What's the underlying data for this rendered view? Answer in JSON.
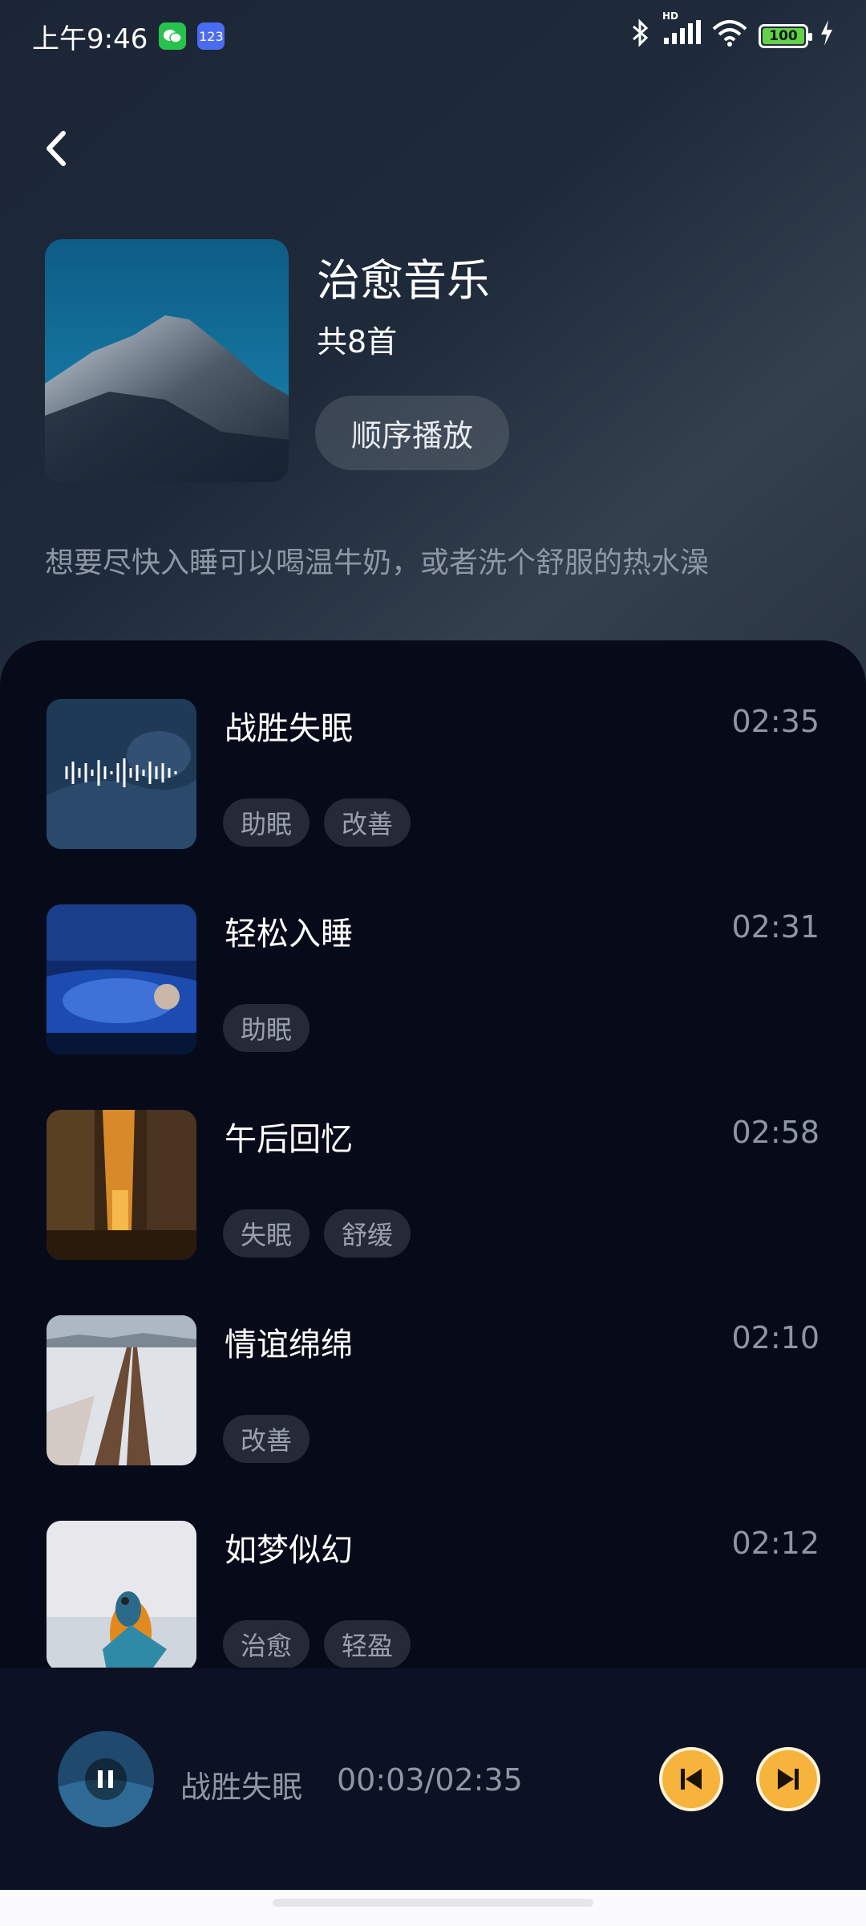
{
  "status_bar": {
    "time": "上午9:46",
    "battery": "100",
    "signal_label": "HD"
  },
  "album": {
    "title": "治愈音乐",
    "count": "共8首",
    "play_order_label": "顺序播放",
    "description": "想要尽快入睡可以喝温牛奶，或者洗个舒服的热水澡"
  },
  "songs": [
    {
      "title": "战胜失眠",
      "duration": "02:35",
      "tags": [
        "助眠",
        "改善"
      ],
      "playing": true
    },
    {
      "title": "轻松入睡",
      "duration": "02:31",
      "tags": [
        "助眠"
      ]
    },
    {
      "title": "午后回忆",
      "duration": "02:58",
      "tags": [
        "失眠",
        "舒缓"
      ]
    },
    {
      "title": "情谊绵绵",
      "duration": "02:10",
      "tags": [
        "改善"
      ]
    },
    {
      "title": "如梦似幻",
      "duration": "02:12",
      "tags": [
        "治愈",
        "轻盈"
      ]
    }
  ],
  "player": {
    "title": "战胜失眠",
    "time": "00:03/02:35"
  },
  "colors": {
    "accent": "#f6b43c",
    "panel": "#070b19",
    "tag_bg": "#262a38"
  },
  "icons": [
    "back-icon",
    "wechat-icon",
    "keyboard-icon",
    "bluetooth-icon",
    "signal-icon",
    "wifi-icon",
    "battery-icon",
    "charging-icon",
    "waveform-icon",
    "pause-icon",
    "previous-icon",
    "next-icon"
  ]
}
